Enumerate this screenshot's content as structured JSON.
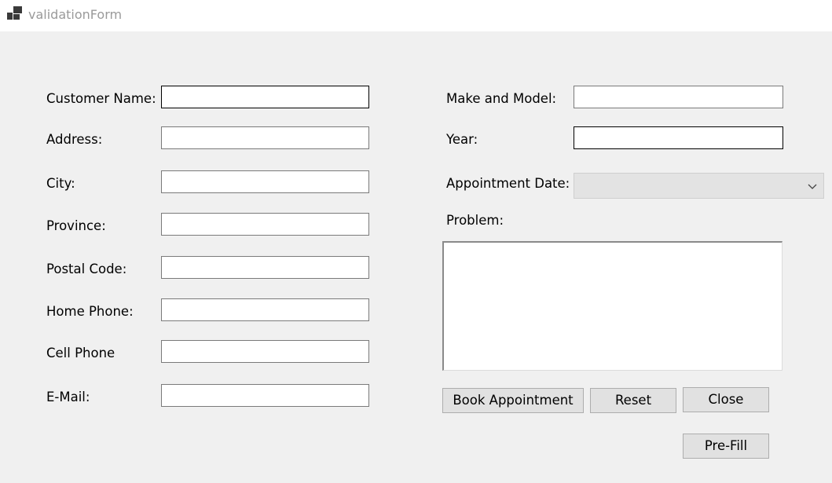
{
  "window": {
    "title": "validationForm",
    "icon": "app-window-icon"
  },
  "customer": {
    "name_label": "Customer Name:",
    "address_label": "Address:",
    "city_label": "City:",
    "province_label": "Province:",
    "postal_label": "Postal Code:",
    "home_phone_label": "Home Phone:",
    "cell_phone_label": "Cell Phone",
    "email_label": "E-Mail:",
    "name_value": "",
    "address_value": "",
    "city_value": "",
    "province_value": "",
    "postal_value": "",
    "home_phone_value": "",
    "cell_phone_value": "",
    "email_value": ""
  },
  "vehicle": {
    "make_model_label": "Make and Model:",
    "year_label": "Year:",
    "appointment_label": "Appointment Date:",
    "problem_label": "Problem:",
    "make_model_value": "",
    "year_value": "",
    "appointment_value": "",
    "problem_value": ""
  },
  "buttons": {
    "book": "Book Appointment",
    "reset": "Reset",
    "close": "Close",
    "prefill": "Pre-Fill"
  },
  "icons": {
    "combo_arrow": "chevron-down-icon"
  }
}
